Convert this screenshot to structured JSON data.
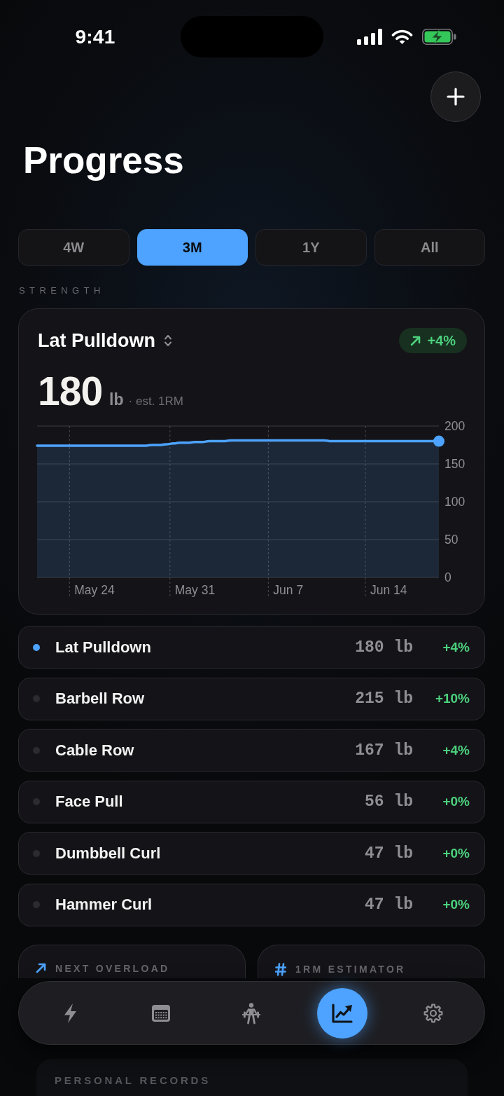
{
  "status_bar": {
    "time": "9:41"
  },
  "header": {
    "title": "Progress"
  },
  "range_tabs": [
    {
      "label": "4W",
      "selected": false
    },
    {
      "label": "3M",
      "selected": true
    },
    {
      "label": "1Y",
      "selected": false
    },
    {
      "label": "All",
      "selected": false
    }
  ],
  "section_label": "STRENGTH",
  "chart_card": {
    "exercise": "Lat Pulldown",
    "change": "+4%",
    "value": "180",
    "unit": "lb",
    "caption": "· est. 1RM",
    "chart_data": {
      "type": "area",
      "categories": [
        null,
        null,
        null,
        null,
        null,
        null,
        null,
        null,
        "May 24",
        null,
        null,
        null,
        null,
        null,
        null,
        null,
        null,
        null,
        null,
        null,
        null,
        null,
        "May 31",
        null,
        null,
        null,
        null,
        null,
        null,
        null,
        null,
        null,
        null,
        null,
        null,
        "Jun 7",
        null,
        null,
        null,
        null,
        null,
        null,
        null,
        null,
        null,
        null,
        null,
        null,
        null,
        "Jun 14",
        null,
        null,
        null,
        null,
        null,
        null,
        null
      ],
      "series": [
        {
          "color": "#4da3ff",
          "values": [
            174,
            174,
            174,
            174,
            174,
            174,
            174,
            174,
            174,
            174,
            174,
            174,
            174,
            174,
            174,
            174,
            175,
            175,
            176,
            177,
            178,
            178,
            179,
            179,
            180,
            180,
            180,
            181,
            181,
            181,
            181,
            181,
            181,
            181,
            181,
            181,
            181,
            181,
            181,
            181,
            181,
            180,
            180,
            180,
            180,
            180,
            180,
            180,
            180,
            180,
            180,
            180,
            180,
            180,
            180,
            180,
            180
          ]
        }
      ],
      "ylim": [
        0,
        200
      ],
      "yticks": [
        0,
        50,
        100,
        150,
        200
      ],
      "grid": true
    }
  },
  "exercises": [
    {
      "name": "Lat Pulldown",
      "value": "180 lb",
      "change": "+4%",
      "selected": true
    },
    {
      "name": "Barbell Row",
      "value": "215 lb",
      "change": "+10%",
      "selected": false
    },
    {
      "name": "Cable Row",
      "value": "167 lb",
      "change": "+4%",
      "selected": false
    },
    {
      "name": "Face Pull",
      "value": "56 lb",
      "change": "+0%",
      "selected": false
    },
    {
      "name": "Dumbbell Curl",
      "value": "47 lb",
      "change": "+0%",
      "selected": false
    },
    {
      "name": "Hammer Curl",
      "value": "47 lb",
      "change": "+0%",
      "selected": false
    }
  ],
  "tool_cards": [
    {
      "title": "NEXT OVERLOAD"
    },
    {
      "title": "1RM ESTIMATOR"
    }
  ],
  "faded_card": {
    "title": "PERSONAL RECORDS"
  },
  "tab_bar": {
    "items": [
      {
        "selected": false
      },
      {
        "selected": false
      },
      {
        "selected": false
      },
      {
        "selected": true
      },
      {
        "selected": false
      }
    ]
  }
}
